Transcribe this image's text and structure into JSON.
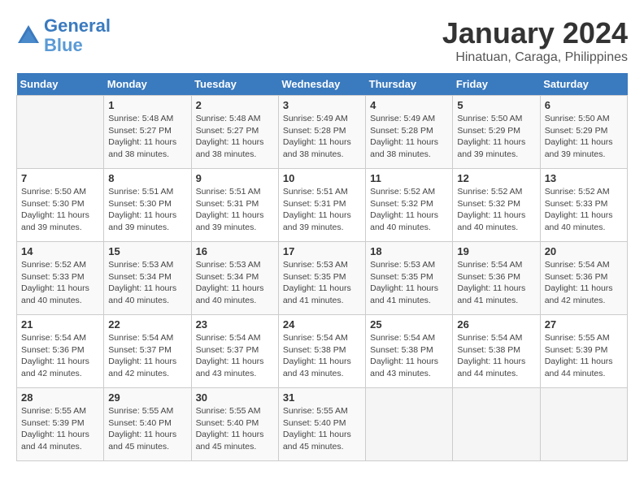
{
  "header": {
    "logo_line1": "General",
    "logo_line2": "Blue",
    "month": "January 2024",
    "location": "Hinatuan, Caraga, Philippines"
  },
  "weekdays": [
    "Sunday",
    "Monday",
    "Tuesday",
    "Wednesday",
    "Thursday",
    "Friday",
    "Saturday"
  ],
  "weeks": [
    [
      {
        "day": "",
        "sunrise": "",
        "sunset": "",
        "daylight": ""
      },
      {
        "day": "1",
        "sunrise": "Sunrise: 5:48 AM",
        "sunset": "Sunset: 5:27 PM",
        "daylight": "Daylight: 11 hours and 38 minutes."
      },
      {
        "day": "2",
        "sunrise": "Sunrise: 5:48 AM",
        "sunset": "Sunset: 5:27 PM",
        "daylight": "Daylight: 11 hours and 38 minutes."
      },
      {
        "day": "3",
        "sunrise": "Sunrise: 5:49 AM",
        "sunset": "Sunset: 5:28 PM",
        "daylight": "Daylight: 11 hours and 38 minutes."
      },
      {
        "day": "4",
        "sunrise": "Sunrise: 5:49 AM",
        "sunset": "Sunset: 5:28 PM",
        "daylight": "Daylight: 11 hours and 38 minutes."
      },
      {
        "day": "5",
        "sunrise": "Sunrise: 5:50 AM",
        "sunset": "Sunset: 5:29 PM",
        "daylight": "Daylight: 11 hours and 39 minutes."
      },
      {
        "day": "6",
        "sunrise": "Sunrise: 5:50 AM",
        "sunset": "Sunset: 5:29 PM",
        "daylight": "Daylight: 11 hours and 39 minutes."
      }
    ],
    [
      {
        "day": "7",
        "sunrise": "Sunrise: 5:50 AM",
        "sunset": "Sunset: 5:30 PM",
        "daylight": "Daylight: 11 hours and 39 minutes."
      },
      {
        "day": "8",
        "sunrise": "Sunrise: 5:51 AM",
        "sunset": "Sunset: 5:30 PM",
        "daylight": "Daylight: 11 hours and 39 minutes."
      },
      {
        "day": "9",
        "sunrise": "Sunrise: 5:51 AM",
        "sunset": "Sunset: 5:31 PM",
        "daylight": "Daylight: 11 hours and 39 minutes."
      },
      {
        "day": "10",
        "sunrise": "Sunrise: 5:51 AM",
        "sunset": "Sunset: 5:31 PM",
        "daylight": "Daylight: 11 hours and 39 minutes."
      },
      {
        "day": "11",
        "sunrise": "Sunrise: 5:52 AM",
        "sunset": "Sunset: 5:32 PM",
        "daylight": "Daylight: 11 hours and 40 minutes."
      },
      {
        "day": "12",
        "sunrise": "Sunrise: 5:52 AM",
        "sunset": "Sunset: 5:32 PM",
        "daylight": "Daylight: 11 hours and 40 minutes."
      },
      {
        "day": "13",
        "sunrise": "Sunrise: 5:52 AM",
        "sunset": "Sunset: 5:33 PM",
        "daylight": "Daylight: 11 hours and 40 minutes."
      }
    ],
    [
      {
        "day": "14",
        "sunrise": "Sunrise: 5:52 AM",
        "sunset": "Sunset: 5:33 PM",
        "daylight": "Daylight: 11 hours and 40 minutes."
      },
      {
        "day": "15",
        "sunrise": "Sunrise: 5:53 AM",
        "sunset": "Sunset: 5:34 PM",
        "daylight": "Daylight: 11 hours and 40 minutes."
      },
      {
        "day": "16",
        "sunrise": "Sunrise: 5:53 AM",
        "sunset": "Sunset: 5:34 PM",
        "daylight": "Daylight: 11 hours and 40 minutes."
      },
      {
        "day": "17",
        "sunrise": "Sunrise: 5:53 AM",
        "sunset": "Sunset: 5:35 PM",
        "daylight": "Daylight: 11 hours and 41 minutes."
      },
      {
        "day": "18",
        "sunrise": "Sunrise: 5:53 AM",
        "sunset": "Sunset: 5:35 PM",
        "daylight": "Daylight: 11 hours and 41 minutes."
      },
      {
        "day": "19",
        "sunrise": "Sunrise: 5:54 AM",
        "sunset": "Sunset: 5:36 PM",
        "daylight": "Daylight: 11 hours and 41 minutes."
      },
      {
        "day": "20",
        "sunrise": "Sunrise: 5:54 AM",
        "sunset": "Sunset: 5:36 PM",
        "daylight": "Daylight: 11 hours and 42 minutes."
      }
    ],
    [
      {
        "day": "21",
        "sunrise": "Sunrise: 5:54 AM",
        "sunset": "Sunset: 5:36 PM",
        "daylight": "Daylight: 11 hours and 42 minutes."
      },
      {
        "day": "22",
        "sunrise": "Sunrise: 5:54 AM",
        "sunset": "Sunset: 5:37 PM",
        "daylight": "Daylight: 11 hours and 42 minutes."
      },
      {
        "day": "23",
        "sunrise": "Sunrise: 5:54 AM",
        "sunset": "Sunset: 5:37 PM",
        "daylight": "Daylight: 11 hours and 43 minutes."
      },
      {
        "day": "24",
        "sunrise": "Sunrise: 5:54 AM",
        "sunset": "Sunset: 5:38 PM",
        "daylight": "Daylight: 11 hours and 43 minutes."
      },
      {
        "day": "25",
        "sunrise": "Sunrise: 5:54 AM",
        "sunset": "Sunset: 5:38 PM",
        "daylight": "Daylight: 11 hours and 43 minutes."
      },
      {
        "day": "26",
        "sunrise": "Sunrise: 5:54 AM",
        "sunset": "Sunset: 5:38 PM",
        "daylight": "Daylight: 11 hours and 44 minutes."
      },
      {
        "day": "27",
        "sunrise": "Sunrise: 5:55 AM",
        "sunset": "Sunset: 5:39 PM",
        "daylight": "Daylight: 11 hours and 44 minutes."
      }
    ],
    [
      {
        "day": "28",
        "sunrise": "Sunrise: 5:55 AM",
        "sunset": "Sunset: 5:39 PM",
        "daylight": "Daylight: 11 hours and 44 minutes."
      },
      {
        "day": "29",
        "sunrise": "Sunrise: 5:55 AM",
        "sunset": "Sunset: 5:40 PM",
        "daylight": "Daylight: 11 hours and 45 minutes."
      },
      {
        "day": "30",
        "sunrise": "Sunrise: 5:55 AM",
        "sunset": "Sunset: 5:40 PM",
        "daylight": "Daylight: 11 hours and 45 minutes."
      },
      {
        "day": "31",
        "sunrise": "Sunrise: 5:55 AM",
        "sunset": "Sunset: 5:40 PM",
        "daylight": "Daylight: 11 hours and 45 minutes."
      },
      {
        "day": "",
        "sunrise": "",
        "sunset": "",
        "daylight": ""
      },
      {
        "day": "",
        "sunrise": "",
        "sunset": "",
        "daylight": ""
      },
      {
        "day": "",
        "sunrise": "",
        "sunset": "",
        "daylight": ""
      }
    ]
  ]
}
